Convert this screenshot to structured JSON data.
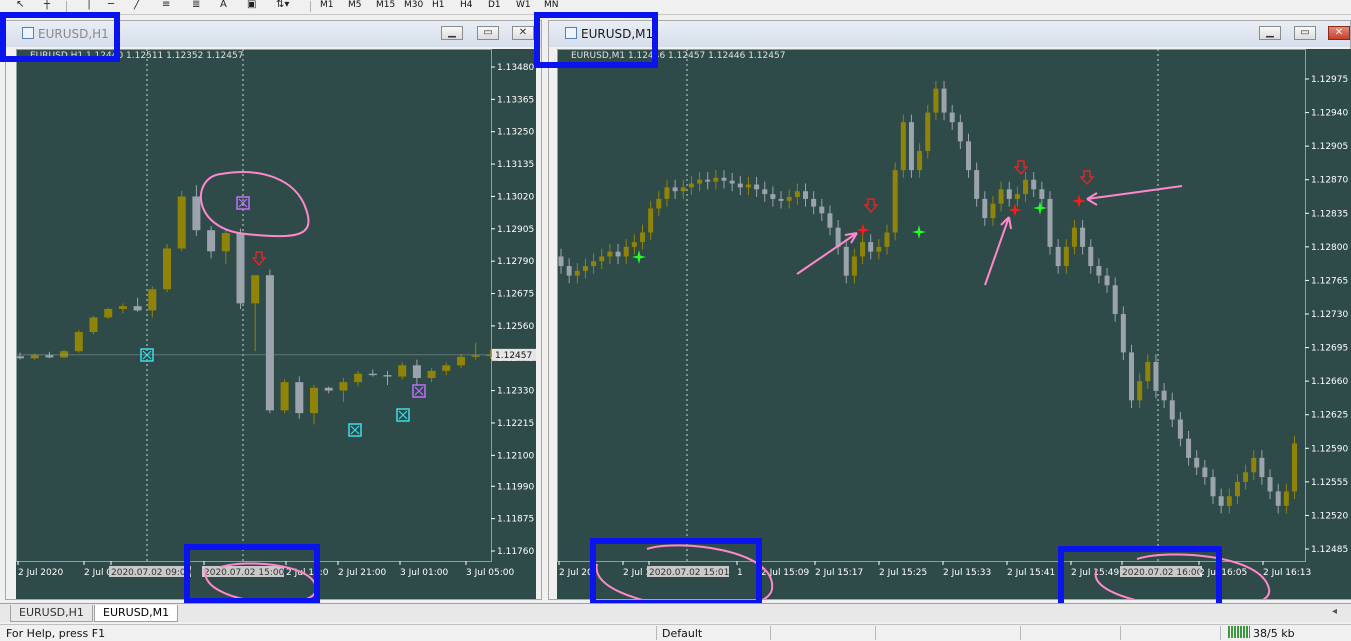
{
  "toolbar": {
    "timeframes": [
      "M1",
      "M5",
      "M15",
      "M30",
      "H1",
      "H4",
      "D1",
      "W1",
      "MN"
    ],
    "tool_icons": [
      "cursor-icon",
      "crosshair-icon",
      "vertical-line-icon",
      "horizontal-line-icon",
      "trendline-icon",
      "equidistant-channel-icon",
      "fibonacci-icon",
      "text-icon",
      "label-icon",
      "arrows-icon"
    ]
  },
  "windows": {
    "h1": {
      "title": "EURUSD,H1",
      "ohlc": "EURUSD,H1  1.12440 1.12511 1.12352 1.12457",
      "current_price": "1.12457",
      "price_levels": [
        "1.13480",
        "1.13365",
        "1.13250",
        "1.13135",
        "1.13020",
        "1.12905",
        "1.12790",
        "1.12675",
        "1.12560",
        "1.12445",
        "1.12330",
        "1.12215",
        "1.12100",
        "1.11990",
        "1.11875",
        "1.11760"
      ],
      "time_labels": [
        "2 Jul 2020",
        "2 Jul 0",
        "2020.07.02 09:00",
        "2020.07.02 15:00",
        "2 Jul 17:0",
        "2 Jul 21:00",
        "3 Jul 01:00",
        "3 Jul 05:00"
      ],
      "candles": [
        [
          1.12452,
          1.12465,
          1.1244,
          1.12445
        ],
        [
          1.12445,
          1.12462,
          1.1244,
          1.12456
        ],
        [
          1.12456,
          1.12468,
          1.12445,
          1.12448
        ],
        [
          1.12448,
          1.12475,
          1.12445,
          1.1247
        ],
        [
          1.1247,
          1.12545,
          1.12465,
          1.12538
        ],
        [
          1.12538,
          1.12595,
          1.1253,
          1.1259
        ],
        [
          1.1259,
          1.12625,
          1.12585,
          1.1262
        ],
        [
          1.1262,
          1.1264,
          1.12605,
          1.1263
        ],
        [
          1.1263,
          1.1266,
          1.1261,
          1.12615
        ],
        [
          1.12615,
          1.127,
          1.1259,
          1.1269
        ],
        [
          1.1269,
          1.1285,
          1.1268,
          1.12835
        ],
        [
          1.12835,
          1.1304,
          1.12825,
          1.1302
        ],
        [
          1.1302,
          1.1306,
          1.1288,
          1.129
        ],
        [
          1.129,
          1.12915,
          1.128,
          1.12825
        ],
        [
          1.12825,
          1.12905,
          1.1278,
          1.1289
        ],
        [
          1.1289,
          1.12905,
          1.1262,
          1.1264
        ],
        [
          1.1264,
          1.1274,
          1.1247,
          1.1274
        ],
        [
          1.1274,
          1.1276,
          1.1225,
          1.1226
        ],
        [
          1.1226,
          1.1237,
          1.1225,
          1.1236
        ],
        [
          1.1236,
          1.1238,
          1.1223,
          1.1225
        ],
        [
          1.1225,
          1.1235,
          1.1221,
          1.1234
        ],
        [
          1.1234,
          1.12345,
          1.1232,
          1.1233
        ],
        [
          1.1233,
          1.12375,
          1.1229,
          1.1236
        ],
        [
          1.1236,
          1.124,
          1.12345,
          1.1239
        ],
        [
          1.1239,
          1.12405,
          1.1238,
          1.12385
        ],
        [
          1.12385,
          1.124,
          1.1235,
          1.1238
        ],
        [
          1.1238,
          1.1243,
          1.1237,
          1.1242
        ],
        [
          1.1242,
          1.1244,
          1.1235,
          1.12375
        ],
        [
          1.12375,
          1.1241,
          1.1236,
          1.124
        ],
        [
          1.124,
          1.1243,
          1.12385,
          1.1242
        ],
        [
          1.1242,
          1.1246,
          1.1241,
          1.1245
        ],
        [
          1.1245,
          1.125,
          1.1244,
          1.12455
        ],
        [
          1.12455,
          1.12475,
          1.12445,
          1.12457
        ]
      ]
    },
    "m1": {
      "title": "EURUSD,M1",
      "ohlc": "EURUSD,M1  1.12446 1.12457 1.12446 1.12457",
      "price_levels": [
        "1.12975",
        "1.12940",
        "1.12905",
        "1.12870",
        "1.12835",
        "1.12800",
        "1.12765",
        "1.12730",
        "1.12695",
        "1.12660",
        "1.12625",
        "1.12590",
        "1.12555",
        "1.12520",
        "1.12485"
      ],
      "time_labels": [
        "2 Jul 20",
        "2 Jul 1",
        "2020.07.02 15:01",
        "1",
        "2 Jul 15:09",
        "2 Jul 15:17",
        "2 Jul 15:25",
        "2 Jul 15:33",
        "2 Jul 15:41",
        "2 Jul 15:49",
        "2020.07.02 16:00",
        "2 Jul 16:05",
        "2 Jul 16:13"
      ]
    }
  },
  "tabs": [
    "EURUSD,H1",
    "EURUSD,M1"
  ],
  "status": {
    "help": "For Help, press F1",
    "profile": "Default",
    "traffic": "38/5 kb"
  },
  "colors": {
    "chart_bg": "#2f4b49",
    "bull": "#8f8407",
    "bear": "#9ba3ad",
    "grid": "#3e5b59",
    "highlight": "#0a14ee",
    "annotation": "#ff88cc"
  }
}
